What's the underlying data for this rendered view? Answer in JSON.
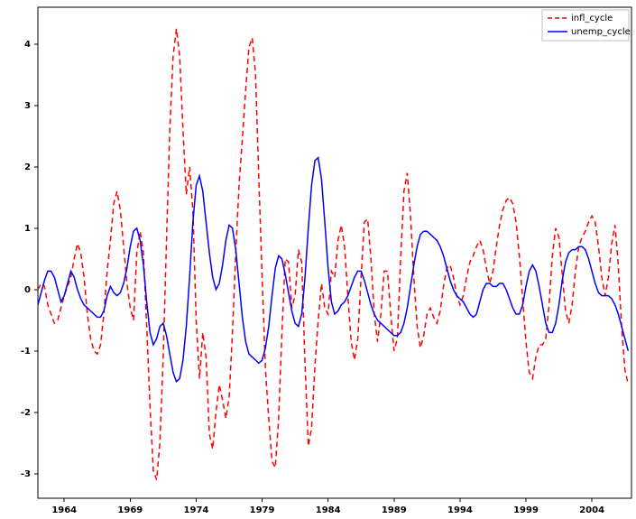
{
  "chart_data": {
    "type": "line",
    "title": "",
    "xlabel": "",
    "ylabel": "",
    "x_ticks": [
      1964,
      1969,
      1974,
      1979,
      1984,
      1989,
      1994,
      1999,
      2004
    ],
    "y_ticks": [
      -3,
      -2,
      -1,
      0,
      1,
      2,
      3,
      4
    ],
    "xlim": [
      1962,
      2007
    ],
    "ylim": [
      -3.4,
      4.6
    ],
    "legend": {
      "position": "upper right",
      "entries": [
        "infl_cycle",
        "unemp_cycle"
      ]
    },
    "series": [
      {
        "name": "infl_cycle",
        "color": "#ff0000",
        "linestyle": "dashed",
        "x": [
          1962.0,
          1962.25,
          1962.5,
          1962.75,
          1963.0,
          1963.25,
          1963.5,
          1963.75,
          1964.0,
          1964.25,
          1964.5,
          1964.75,
          1965.0,
          1965.25,
          1965.5,
          1965.75,
          1966.0,
          1966.25,
          1966.5,
          1966.75,
          1967.0,
          1967.25,
          1967.5,
          1967.75,
          1968.0,
          1968.25,
          1968.5,
          1968.75,
          1969.0,
          1969.25,
          1969.5,
          1969.75,
          1970.0,
          1970.25,
          1970.5,
          1970.75,
          1971.0,
          1971.25,
          1971.5,
          1971.75,
          1972.0,
          1972.25,
          1972.5,
          1972.75,
          1973.0,
          1973.25,
          1973.5,
          1973.75,
          1974.0,
          1974.25,
          1974.5,
          1974.75,
          1975.0,
          1975.25,
          1975.5,
          1975.75,
          1976.0,
          1976.25,
          1976.5,
          1976.75,
          1977.0,
          1977.25,
          1977.5,
          1977.75,
          1978.0,
          1978.25,
          1978.5,
          1978.75,
          1979.0,
          1979.25,
          1979.5,
          1979.75,
          1980.0,
          1980.25,
          1980.5,
          1980.75,
          1981.0,
          1981.25,
          1981.5,
          1981.75,
          1982.0,
          1982.25,
          1982.5,
          1982.75,
          1983.0,
          1983.25,
          1983.5,
          1983.75,
          1984.0,
          1984.25,
          1984.5,
          1984.75,
          1985.0,
          1985.25,
          1985.5,
          1985.75,
          1986.0,
          1986.25,
          1986.5,
          1986.75,
          1987.0,
          1987.25,
          1987.5,
          1987.75,
          1988.0,
          1988.25,
          1988.5,
          1988.75,
          1989.0,
          1989.25,
          1989.5,
          1989.75,
          1990.0,
          1990.25,
          1990.5,
          1990.75,
          1991.0,
          1991.25,
          1991.5,
          1991.75,
          1992.0,
          1992.25,
          1992.5,
          1992.75,
          1993.0,
          1993.25,
          1993.5,
          1993.75,
          1994.0,
          1994.25,
          1994.5,
          1994.75,
          1995.0,
          1995.25,
          1995.5,
          1995.75,
          1996.0,
          1996.25,
          1996.5,
          1996.75,
          1997.0,
          1997.25,
          1997.5,
          1997.75,
          1998.0,
          1998.25,
          1998.5,
          1998.75,
          1999.0,
          1999.25,
          1999.5,
          1999.75,
          2000.0,
          2000.25,
          2000.5,
          2000.75,
          2001.0,
          2001.25,
          2001.5,
          2001.75,
          2002.0,
          2002.25,
          2002.5,
          2002.75,
          2003.0,
          2003.25,
          2003.5,
          2003.75,
          2004.0,
          2004.25,
          2004.5,
          2004.75,
          2005.0,
          2005.25,
          2005.5,
          2005.75,
          2006.0,
          2006.25,
          2006.5,
          2006.75
        ],
        "values": [
          0.0,
          0.1,
          0.05,
          -0.25,
          -0.4,
          -0.55,
          -0.5,
          -0.3,
          -0.1,
          0.05,
          0.2,
          0.5,
          0.75,
          0.6,
          0.2,
          -0.4,
          -0.8,
          -1.0,
          -1.05,
          -0.9,
          -0.4,
          0.3,
          0.8,
          1.4,
          1.6,
          1.3,
          0.7,
          0.1,
          -0.3,
          -0.5,
          0.6,
          0.95,
          0.6,
          -0.6,
          -1.9,
          -2.95,
          -3.1,
          -2.5,
          -1.1,
          0.8,
          2.6,
          3.8,
          4.25,
          3.8,
          2.6,
          1.55,
          2.0,
          1.3,
          -0.5,
          -1.45,
          -0.7,
          -1.1,
          -2.35,
          -2.6,
          -2.0,
          -1.55,
          -1.8,
          -2.1,
          -1.75,
          -0.7,
          0.6,
          1.7,
          2.45,
          3.25,
          3.95,
          4.1,
          3.5,
          1.8,
          0.2,
          -1.3,
          -2.1,
          -2.8,
          -2.9,
          -2.1,
          -0.7,
          0.5,
          0.45,
          -0.3,
          -0.1,
          0.65,
          0.45,
          -1.2,
          -2.55,
          -2.25,
          -1.25,
          -0.5,
          0.1,
          -0.3,
          -0.4,
          0.3,
          0.2,
          0.8,
          1.05,
          0.7,
          -0.1,
          -0.85,
          -1.15,
          -0.8,
          0.2,
          1.1,
          1.15,
          0.5,
          -0.4,
          -0.85,
          -0.4,
          0.3,
          0.3,
          -0.4,
          -1.0,
          -0.8,
          0.5,
          1.6,
          1.9,
          1.2,
          0.2,
          -0.6,
          -0.95,
          -0.75,
          -0.4,
          -0.3,
          -0.45,
          -0.55,
          -0.35,
          0.05,
          0.35,
          0.4,
          0.2,
          -0.1,
          -0.25,
          -0.1,
          0.2,
          0.45,
          0.55,
          0.7,
          0.8,
          0.65,
          0.35,
          0.1,
          0.3,
          0.7,
          1.05,
          1.3,
          1.45,
          1.5,
          1.4,
          1.1,
          0.55,
          -0.15,
          -0.85,
          -1.35,
          -1.45,
          -1.1,
          -0.9,
          -0.9,
          -0.8,
          -0.25,
          0.55,
          1.0,
          0.85,
          0.25,
          -0.35,
          -0.55,
          -0.25,
          0.3,
          0.7,
          0.85,
          0.95,
          1.1,
          1.2,
          1.1,
          0.7,
          0.2,
          -0.1,
          0.2,
          0.75,
          1.05,
          0.4,
          -0.6,
          -1.3,
          -1.55
        ]
      },
      {
        "name": "unemp_cycle",
        "color": "#0000ff",
        "linestyle": "solid",
        "x": [
          1962.0,
          1962.25,
          1962.5,
          1962.75,
          1963.0,
          1963.25,
          1963.5,
          1963.75,
          1964.0,
          1964.25,
          1964.5,
          1964.75,
          1965.0,
          1965.25,
          1965.5,
          1965.75,
          1966.0,
          1966.25,
          1966.5,
          1966.75,
          1967.0,
          1967.25,
          1967.5,
          1967.75,
          1968.0,
          1968.25,
          1968.5,
          1968.75,
          1969.0,
          1969.25,
          1969.5,
          1969.75,
          1970.0,
          1970.25,
          1970.5,
          1970.75,
          1971.0,
          1971.25,
          1971.5,
          1971.75,
          1972.0,
          1972.25,
          1972.5,
          1972.75,
          1973.0,
          1973.25,
          1973.5,
          1973.75,
          1974.0,
          1974.25,
          1974.5,
          1974.75,
          1975.0,
          1975.25,
          1975.5,
          1975.75,
          1976.0,
          1976.25,
          1976.5,
          1976.75,
          1977.0,
          1977.25,
          1977.5,
          1977.75,
          1978.0,
          1978.25,
          1978.5,
          1978.75,
          1979.0,
          1979.25,
          1979.5,
          1979.75,
          1980.0,
          1980.25,
          1980.5,
          1980.75,
          1981.0,
          1981.25,
          1981.5,
          1981.75,
          1982.0,
          1982.25,
          1982.5,
          1982.75,
          1983.0,
          1983.25,
          1983.5,
          1983.75,
          1984.0,
          1984.25,
          1984.5,
          1984.75,
          1985.0,
          1985.25,
          1985.5,
          1985.75,
          1986.0,
          1986.25,
          1986.5,
          1986.75,
          1987.0,
          1987.25,
          1987.5,
          1987.75,
          1988.0,
          1988.25,
          1988.5,
          1988.75,
          1989.0,
          1989.25,
          1989.5,
          1989.75,
          1990.0,
          1990.25,
          1990.5,
          1990.75,
          1991.0,
          1991.25,
          1991.5,
          1991.75,
          1992.0,
          1992.25,
          1992.5,
          1992.75,
          1993.0,
          1993.25,
          1993.5,
          1993.75,
          1994.0,
          1994.25,
          1994.5,
          1994.75,
          1995.0,
          1995.25,
          1995.5,
          1995.75,
          1996.0,
          1996.25,
          1996.5,
          1996.75,
          1997.0,
          1997.25,
          1997.5,
          1997.75,
          1998.0,
          1998.25,
          1998.5,
          1998.75,
          1999.0,
          1999.25,
          1999.5,
          1999.75,
          2000.0,
          2000.25,
          2000.5,
          2000.75,
          2001.0,
          2001.25,
          2001.5,
          2001.75,
          2002.0,
          2002.25,
          2002.5,
          2002.75,
          2003.0,
          2003.25,
          2003.5,
          2003.75,
          2004.0,
          2004.25,
          2004.5,
          2004.75,
          2005.0,
          2005.25,
          2005.5,
          2005.75,
          2006.0,
          2006.25,
          2006.5,
          2006.75
        ],
        "values": [
          -0.25,
          -0.05,
          0.15,
          0.3,
          0.3,
          0.2,
          0.0,
          -0.2,
          -0.1,
          0.1,
          0.3,
          0.2,
          0.0,
          -0.15,
          -0.25,
          -0.3,
          -0.35,
          -0.4,
          -0.45,
          -0.45,
          -0.35,
          -0.1,
          0.05,
          -0.05,
          -0.1,
          -0.05,
          0.1,
          0.35,
          0.7,
          0.95,
          1.0,
          0.8,
          0.4,
          -0.2,
          -0.7,
          -0.9,
          -0.8,
          -0.6,
          -0.55,
          -0.75,
          -1.05,
          -1.35,
          -1.5,
          -1.45,
          -1.15,
          -0.6,
          0.2,
          1.1,
          1.7,
          1.85,
          1.6,
          1.1,
          0.6,
          0.2,
          0.0,
          0.1,
          0.4,
          0.8,
          1.05,
          1.0,
          0.65,
          0.1,
          -0.45,
          -0.85,
          -1.05,
          -1.1,
          -1.15,
          -1.2,
          -1.15,
          -0.95,
          -0.6,
          -0.1,
          0.35,
          0.55,
          0.5,
          0.25,
          -0.05,
          -0.35,
          -0.55,
          -0.6,
          -0.4,
          0.2,
          1.0,
          1.7,
          2.1,
          2.15,
          1.8,
          1.1,
          0.35,
          -0.2,
          -0.4,
          -0.35,
          -0.25,
          -0.2,
          -0.1,
          0.05,
          0.2,
          0.3,
          0.3,
          0.15,
          -0.05,
          -0.25,
          -0.4,
          -0.5,
          -0.55,
          -0.6,
          -0.65,
          -0.7,
          -0.75,
          -0.75,
          -0.7,
          -0.55,
          -0.3,
          0.05,
          0.4,
          0.7,
          0.9,
          0.95,
          0.95,
          0.9,
          0.85,
          0.8,
          0.7,
          0.55,
          0.35,
          0.15,
          0.0,
          -0.1,
          -0.15,
          -0.2,
          -0.3,
          -0.4,
          -0.45,
          -0.4,
          -0.2,
          0.0,
          0.1,
          0.1,
          0.05,
          0.05,
          0.1,
          0.1,
          0.0,
          -0.15,
          -0.3,
          -0.4,
          -0.4,
          -0.25,
          0.05,
          0.3,
          0.4,
          0.3,
          0.05,
          -0.25,
          -0.55,
          -0.7,
          -0.7,
          -0.55,
          -0.25,
          0.15,
          0.45,
          0.6,
          0.65,
          0.65,
          0.7,
          0.7,
          0.65,
          0.5,
          0.3,
          0.1,
          -0.05,
          -0.1,
          -0.1,
          -0.1,
          -0.15,
          -0.25,
          -0.4,
          -0.6,
          -0.8,
          -1.0
        ]
      }
    ]
  }
}
